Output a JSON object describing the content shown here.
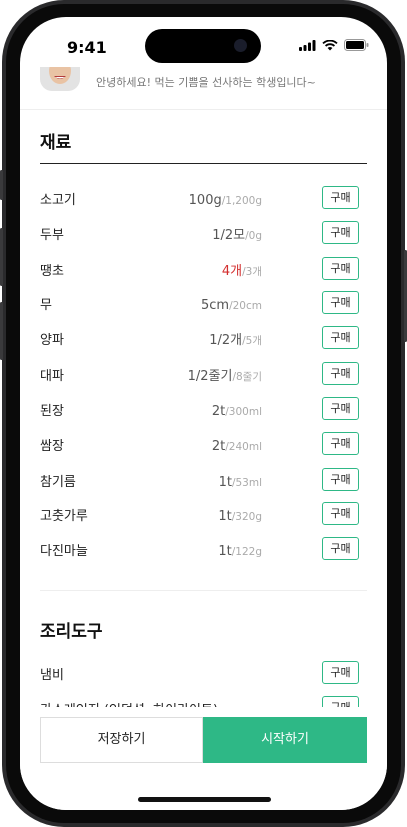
{
  "status": {
    "time": "9:41"
  },
  "profile": {
    "greeting": "안녕하세요! 먹는 기쁨을 선사하는 학생입니다~"
  },
  "ingredients": {
    "title": "재료",
    "buy_label": "구매",
    "items": [
      {
        "name": "소고기",
        "amount": "100g",
        "total": "/1,200g",
        "short": false
      },
      {
        "name": "두부",
        "amount": "1/2모",
        "total": "/0g",
        "short": false
      },
      {
        "name": "땡초",
        "amount": "4개",
        "total": "/3개",
        "short": true
      },
      {
        "name": "무",
        "amount": "5cm",
        "total": "/20cm",
        "short": false
      },
      {
        "name": "양파",
        "amount": "1/2개",
        "total": "/5개",
        "short": false
      },
      {
        "name": "대파",
        "amount": "1/2줄기",
        "total": "/8줄기",
        "short": false
      },
      {
        "name": "된장",
        "amount": "2t",
        "total": "/300ml",
        "short": false
      },
      {
        "name": "쌈장",
        "amount": "2t",
        "total": "/240ml",
        "short": false
      },
      {
        "name": "참기름",
        "amount": "1t",
        "total": "/53ml",
        "short": false
      },
      {
        "name": "고춧가루",
        "amount": "1t",
        "total": "/320g",
        "short": false
      },
      {
        "name": "다진마늘",
        "amount": "1t",
        "total": "/122g",
        "short": false
      }
    ]
  },
  "tools": {
    "title": "조리도구",
    "buy_label": "구매",
    "items": [
      {
        "name": "냄비"
      },
      {
        "name": "가스레인지 (인덕션, 하이라이트)"
      }
    ]
  },
  "actions": {
    "save_label": "저장하기",
    "start_label": "시작하기"
  },
  "colors": {
    "accent": "#2eb886",
    "warning": "#d32f2f"
  }
}
